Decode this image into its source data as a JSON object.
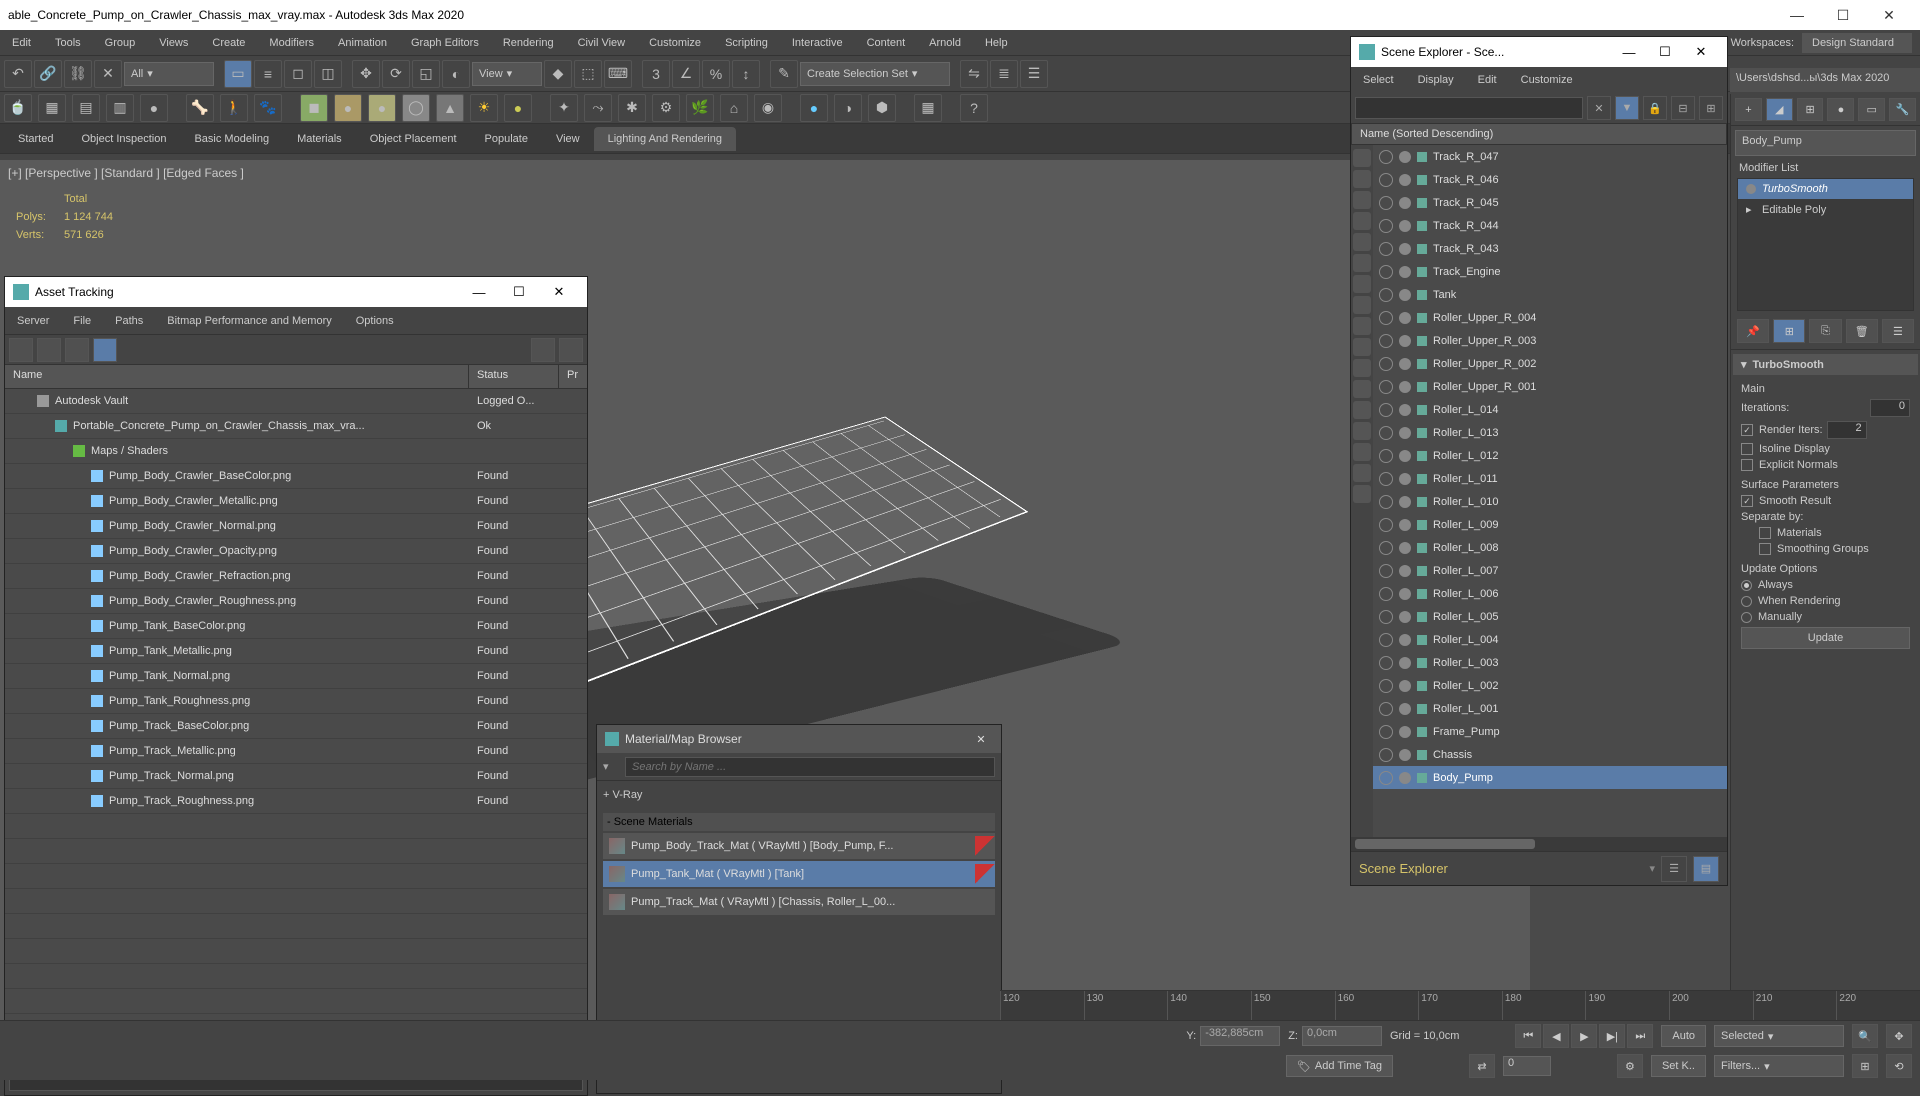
{
  "title": "able_Concrete_Pump_on_Crawler_Chassis_max_vray.max - Autodesk 3ds Max 2020",
  "workspace": {
    "label": "Workspaces:",
    "value": "Design Standard"
  },
  "menu": [
    "Edit",
    "Tools",
    "Group",
    "Views",
    "Create",
    "Modifiers",
    "Animation",
    "Graph Editors",
    "Rendering",
    "Civil View",
    "Customize",
    "Scripting",
    "Interactive",
    "Content",
    "Arnold",
    "Help"
  ],
  "toolbar1": {
    "dd1": "All",
    "dd2": "View",
    "selset": "Create Selection Set"
  },
  "tabs": [
    "Started",
    "Object Inspection",
    "Basic Modeling",
    "Materials",
    "Object Placement",
    "Populate",
    "View",
    "Lighting And Rendering"
  ],
  "tabs_active": 7,
  "viewport": {
    "label": "[+] [Perspective ] [Standard ] [Edged Faces ]",
    "stats": {
      "total": "Total",
      "polys_l": "Polys:",
      "polys_v": "1 124 744",
      "verts_l": "Verts:",
      "verts_v": "571 626"
    }
  },
  "path_breadcrumb": "\\Users\\dshsd...ы\\3ds Max 2020",
  "cmd": {
    "obj": "Body_Pump",
    "modlist_label": "Modifier List",
    "stack": [
      "TurboSmooth",
      "Editable Poly"
    ],
    "stack_sel": 0,
    "roll_title": "TurboSmooth",
    "main": "Main",
    "iterations_l": "Iterations:",
    "iterations_v": "0",
    "renderiters_l": "Render Iters:",
    "renderiters_v": "2",
    "isoline": "Isoline Display",
    "explicit": "Explicit Normals",
    "surf_hdr": "Surface Parameters",
    "smooth_result": "Smooth Result",
    "sep_by": "Separate by:",
    "sep_mat": "Materials",
    "sep_smg": "Smoothing Groups",
    "upd_hdr": "Update Options",
    "upd_always": "Always",
    "upd_render": "When Rendering",
    "upd_manual": "Manually",
    "upd_btn": "Update"
  },
  "scene": {
    "title": "Scene Explorer - Sce...",
    "menu": [
      "Select",
      "Display",
      "Edit",
      "Customize"
    ],
    "colhdr": "Name (Sorted Descending)",
    "items": [
      "Track_R_047",
      "Track_R_046",
      "Track_R_045",
      "Track_R_044",
      "Track_R_043",
      "Track_Engine",
      "Tank",
      "Roller_Upper_R_004",
      "Roller_Upper_R_003",
      "Roller_Upper_R_002",
      "Roller_Upper_R_001",
      "Roller_L_014",
      "Roller_L_013",
      "Roller_L_012",
      "Roller_L_011",
      "Roller_L_010",
      "Roller_L_009",
      "Roller_L_008",
      "Roller_L_007",
      "Roller_L_006",
      "Roller_L_005",
      "Roller_L_004",
      "Roller_L_003",
      "Roller_L_002",
      "Roller_L_001",
      "Frame_Pump",
      "Chassis",
      "Body_Pump"
    ],
    "sel": 27,
    "footer": "Scene Explorer"
  },
  "asset": {
    "title": "Asset Tracking",
    "menu": [
      "Server",
      "File",
      "Paths",
      "Bitmap Performance and Memory",
      "Options"
    ],
    "cols": {
      "name": "Name",
      "status": "Status",
      "proxy": "Pr"
    },
    "rows": [
      {
        "indent": 1,
        "icon": "#999",
        "name": "Autodesk Vault",
        "status": "Logged O..."
      },
      {
        "indent": 2,
        "icon": "#5aa",
        "name": "Portable_Concrete_Pump_on_Crawler_Chassis_max_vra...",
        "status": "Ok"
      },
      {
        "indent": 3,
        "icon": "#6b4",
        "name": "Maps / Shaders",
        "status": ""
      },
      {
        "indent": 4,
        "icon": "#8cf",
        "name": "Pump_Body_Crawler_BaseColor.png",
        "status": "Found"
      },
      {
        "indent": 4,
        "icon": "#8cf",
        "name": "Pump_Body_Crawler_Metallic.png",
        "status": "Found"
      },
      {
        "indent": 4,
        "icon": "#8cf",
        "name": "Pump_Body_Crawler_Normal.png",
        "status": "Found"
      },
      {
        "indent": 4,
        "icon": "#8cf",
        "name": "Pump_Body_Crawler_Opacity.png",
        "status": "Found"
      },
      {
        "indent": 4,
        "icon": "#8cf",
        "name": "Pump_Body_Crawler_Refraction.png",
        "status": "Found"
      },
      {
        "indent": 4,
        "icon": "#8cf",
        "name": "Pump_Body_Crawler_Roughness.png",
        "status": "Found"
      },
      {
        "indent": 4,
        "icon": "#8cf",
        "name": "Pump_Tank_BaseColor.png",
        "status": "Found"
      },
      {
        "indent": 4,
        "icon": "#8cf",
        "name": "Pump_Tank_Metallic.png",
        "status": "Found"
      },
      {
        "indent": 4,
        "icon": "#8cf",
        "name": "Pump_Tank_Normal.png",
        "status": "Found"
      },
      {
        "indent": 4,
        "icon": "#8cf",
        "name": "Pump_Tank_Roughness.png",
        "status": "Found"
      },
      {
        "indent": 4,
        "icon": "#8cf",
        "name": "Pump_Track_BaseColor.png",
        "status": "Found"
      },
      {
        "indent": 4,
        "icon": "#8cf",
        "name": "Pump_Track_Metallic.png",
        "status": "Found"
      },
      {
        "indent": 4,
        "icon": "#8cf",
        "name": "Pump_Track_Normal.png",
        "status": "Found"
      },
      {
        "indent": 4,
        "icon": "#8cf",
        "name": "Pump_Track_Roughness.png",
        "status": "Found"
      }
    ]
  },
  "mat": {
    "title": "Material/Map Browser",
    "search_ph": "Search by Name ...",
    "vray": "+ V-Ray",
    "scene_hdr": "- Scene Materials",
    "rows": [
      "Pump_Body_Track_Mat  ( VRayMtl )  [Body_Pump, F...",
      "Pump_Tank_Mat  ( VRayMtl )  [Tank]",
      "Pump_Track_Mat  ( VRayMtl )  [Chassis, Roller_L_00..."
    ],
    "sel": 1
  },
  "bottom": {
    "y_l": "Y:",
    "y_v": "-382,885cm",
    "z_l": "Z:",
    "z_v": "0,0cm",
    "grid": "Grid = 10,0cm",
    "auto": "Auto",
    "setk": "Set K..",
    "selected": "Selected",
    "filters": "Filters...",
    "addtag": "Add Time Tag",
    "frame": "0",
    "ticks": [
      "120",
      "130",
      "140",
      "150",
      "160",
      "170",
      "180",
      "190",
      "200",
      "210",
      "220"
    ]
  }
}
